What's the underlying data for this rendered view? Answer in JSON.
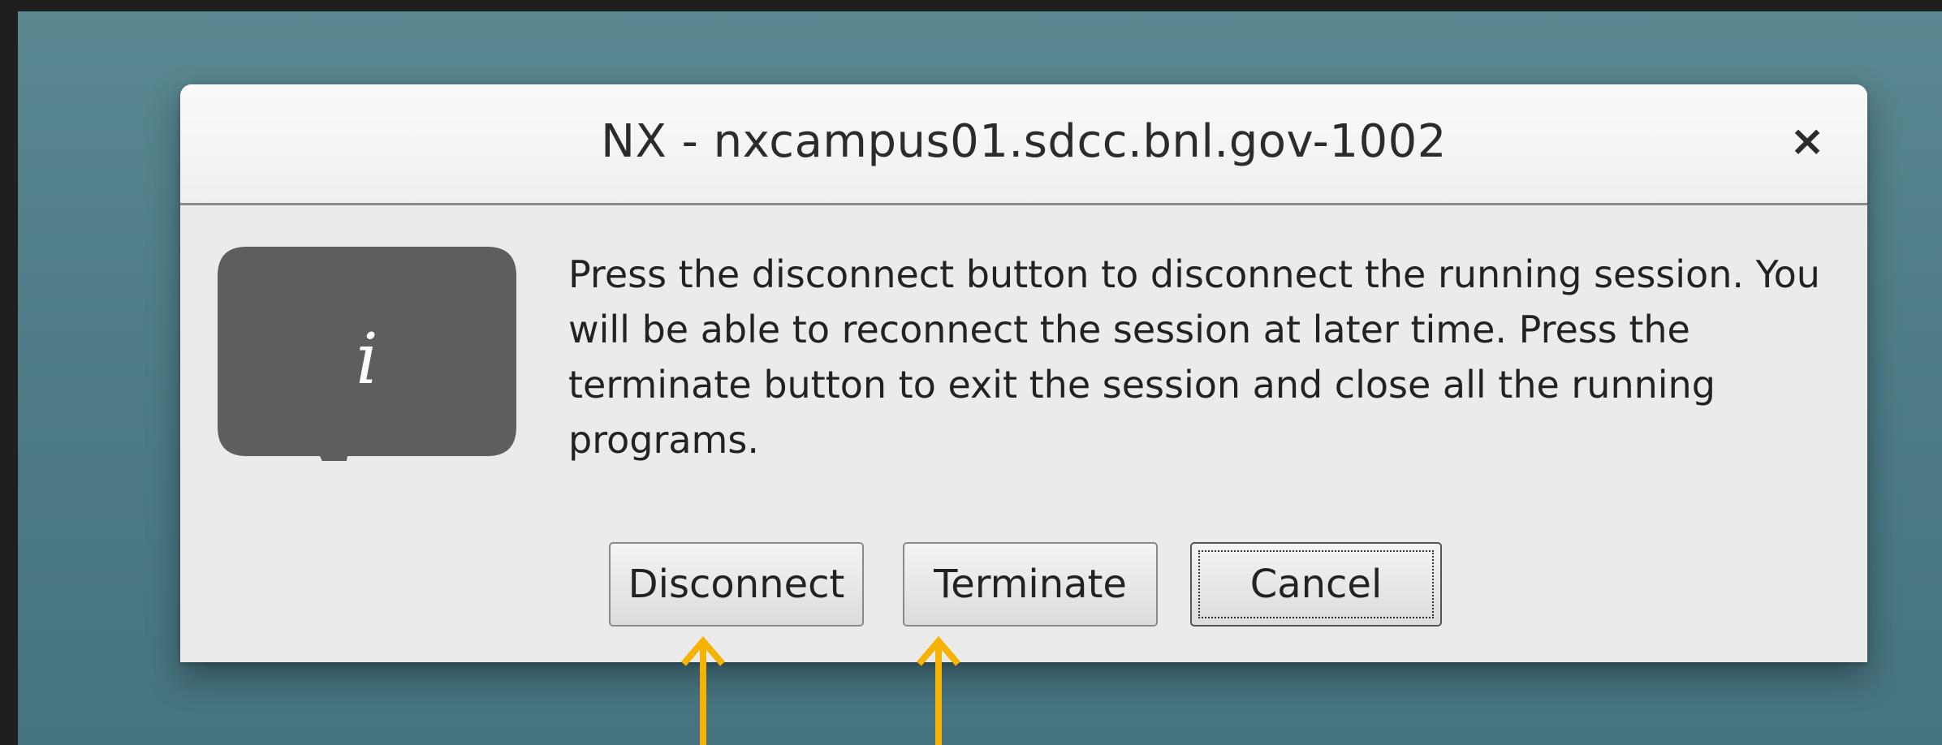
{
  "dialog": {
    "title": "NX - nxcampus01.sdcc.bnl.gov-1002",
    "close_label": "×",
    "icon": "info-icon",
    "icon_glyph": "i",
    "message": "Press the disconnect button to disconnect the running session. You will be able to reconnect the session at later time. Press the terminate button to exit the session and close all the running programs."
  },
  "buttons": {
    "disconnect": "Disconnect",
    "terminate": "Terminate",
    "cancel": "Cancel"
  },
  "colors": {
    "desktop": "#4d7a86",
    "dialog": "#ebebeb",
    "icon": "#5e5e5e",
    "annotation_arrow": "#f5b200"
  },
  "annotations": [
    "arrow-up-icon",
    "arrow-up-icon"
  ]
}
